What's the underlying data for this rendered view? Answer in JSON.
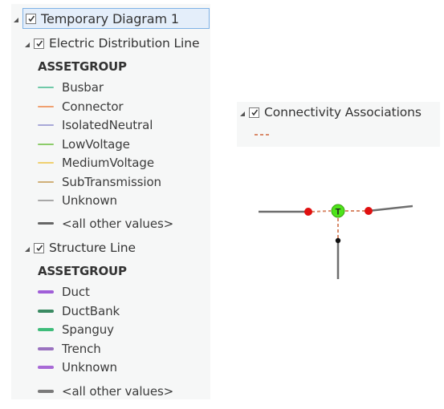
{
  "tree": {
    "root": {
      "label": "Temporary Diagram 1",
      "checked": true,
      "selected": true
    },
    "layers": [
      {
        "label": "Electric Distribution Line",
        "checked": true,
        "field": "ASSETGROUP",
        "items": [
          {
            "label": "Busbar",
            "color": "#6fc9a8"
          },
          {
            "label": "Connector",
            "color": "#f0a070"
          },
          {
            "label": "IsolatedNeutral",
            "color": "#a8a8d8"
          },
          {
            "label": "LowVoltage",
            "color": "#8ccc6a"
          },
          {
            "label": "MediumVoltage",
            "color": "#f0d070"
          },
          {
            "label": "SubTransmission",
            "color": "#d0b078"
          },
          {
            "label": "Unknown",
            "color": "#a8a8a8"
          },
          {
            "label": "<all other values>",
            "color": "#666666"
          }
        ]
      },
      {
        "label": "Structure Line",
        "checked": true,
        "field": "ASSETGROUP",
        "items": [
          {
            "label": "Duct",
            "color": "#a05ed8"
          },
          {
            "label": "DuctBank",
            "color": "#3a8a62"
          },
          {
            "label": "Spanguy",
            "color": "#3ebc7a"
          },
          {
            "label": "Trench",
            "color": "#9a72c0"
          },
          {
            "label": "Unknown",
            "color": "#a86ad6"
          },
          {
            "label": "<all other values>",
            "color": "#7a7a7a"
          }
        ]
      }
    ]
  },
  "associations_panel": {
    "label": "Connectivity Associations",
    "checked": true,
    "swatch_color": "#d98a6a"
  },
  "diagram": {
    "junction_label": "T",
    "colors": {
      "edge": "#6e6e6e",
      "association": "#d98a6a",
      "endpoint": "#e01010",
      "junction": "#4ee41a",
      "vertex": "#111111"
    }
  }
}
